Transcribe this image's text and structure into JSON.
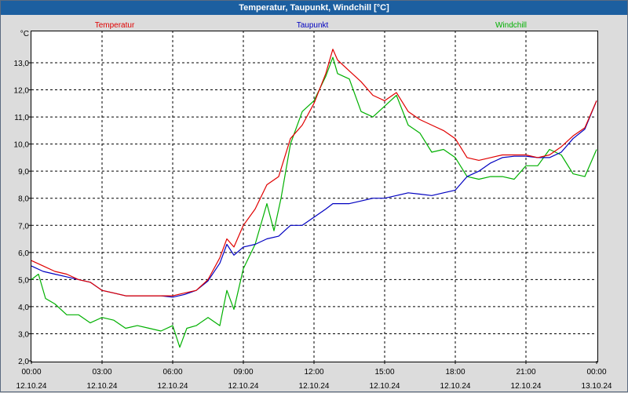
{
  "window": {
    "title": "Temperatur, Taupunkt, Windchill [°C]"
  },
  "chart_data": {
    "type": "line",
    "title": "Temperatur, Taupunkt, Windchill [°C]",
    "ylabel": "°C",
    "xlabel": "",
    "ylim": [
      2.0,
      14.0
    ],
    "xlim_hours": [
      0,
      24
    ],
    "y_ticks": [
      "2,0",
      "3,0",
      "4,0",
      "5,0",
      "6,0",
      "7,0",
      "8,0",
      "9,0",
      "10,0",
      "11,0",
      "12,0",
      "13,0"
    ],
    "x_ticks": [
      {
        "time": "00:00",
        "date": "12.10.24"
      },
      {
        "time": "03:00",
        "date": "12.10.24"
      },
      {
        "time": "06:00",
        "date": "12.10.24"
      },
      {
        "time": "09:00",
        "date": "12.10.24"
      },
      {
        "time": "12:00",
        "date": "12.10.24"
      },
      {
        "time": "15:00",
        "date": "12.10.24"
      },
      {
        "time": "18:00",
        "date": "12.10.24"
      },
      {
        "time": "21:00",
        "date": "12.10.24"
      },
      {
        "time": "00:00",
        "date": "13.10.24"
      }
    ],
    "grid": true,
    "legend_placement": "top",
    "series": [
      {
        "name": "Temperatur",
        "color": "#e00000",
        "x": [
          0,
          0.5,
          1,
          1.5,
          2,
          2.5,
          3,
          3.5,
          4,
          4.5,
          5,
          5.5,
          6,
          6.5,
          7,
          7.5,
          8,
          8.3,
          8.6,
          9,
          9.5,
          10,
          10.5,
          11,
          11.5,
          12,
          12.5,
          12.8,
          13,
          13.5,
          14,
          14.5,
          15,
          15.5,
          16,
          16.5,
          17,
          17.5,
          18,
          18.5,
          19,
          19.5,
          20,
          20.5,
          21,
          21.5,
          22,
          22.5,
          23,
          23.5,
          24
        ],
        "y": [
          5.7,
          5.5,
          5.3,
          5.2,
          5.0,
          4.9,
          4.6,
          4.5,
          4.4,
          4.4,
          4.4,
          4.4,
          4.4,
          4.5,
          4.6,
          5.0,
          5.8,
          6.5,
          6.2,
          7.0,
          7.6,
          8.5,
          8.8,
          10.2,
          10.7,
          11.5,
          12.6,
          13.5,
          13.1,
          12.7,
          12.3,
          11.8,
          11.6,
          11.9,
          11.2,
          10.9,
          10.7,
          10.5,
          10.2,
          9.5,
          9.4,
          9.5,
          9.6,
          9.6,
          9.6,
          9.5,
          9.6,
          9.9,
          10.3,
          10.6,
          11.6
        ]
      },
      {
        "name": "Taupunkt",
        "color": "#0000c0",
        "x": [
          0,
          0.5,
          1,
          1.5,
          2,
          2.5,
          3,
          3.5,
          4,
          4.5,
          5,
          5.5,
          6,
          6.5,
          7,
          7.5,
          8,
          8.3,
          8.6,
          9,
          9.5,
          10,
          10.5,
          11,
          11.5,
          12,
          12.5,
          12.8,
          13,
          13.5,
          14,
          14.5,
          15,
          15.5,
          16,
          16.5,
          17,
          17.5,
          18,
          18.5,
          19,
          19.5,
          20,
          20.5,
          21,
          21.5,
          22,
          22.5,
          23,
          23.5,
          24
        ],
        "y": [
          5.5,
          5.3,
          5.2,
          5.1,
          5.0,
          4.9,
          4.6,
          4.5,
          4.4,
          4.4,
          4.4,
          4.4,
          4.35,
          4.45,
          4.6,
          4.95,
          5.6,
          6.3,
          5.9,
          6.2,
          6.3,
          6.5,
          6.6,
          7.0,
          7.0,
          7.3,
          7.6,
          7.8,
          7.8,
          7.8,
          7.9,
          8.0,
          8.0,
          8.1,
          8.2,
          8.15,
          8.1,
          8.2,
          8.3,
          8.8,
          9.0,
          9.3,
          9.5,
          9.55,
          9.55,
          9.5,
          9.5,
          9.7,
          10.2,
          10.55,
          11.6
        ]
      },
      {
        "name": "Windchill",
        "color": "#00b000",
        "x": [
          0,
          0.3,
          0.6,
          1,
          1.5,
          2,
          2.5,
          3,
          3.5,
          4,
          4.5,
          5,
          5.5,
          6,
          6.3,
          6.6,
          7,
          7.5,
          8,
          8.3,
          8.6,
          9,
          9.5,
          10,
          10.3,
          10.6,
          11,
          11.5,
          12,
          12.5,
          12.8,
          13,
          13.5,
          14,
          14.5,
          15,
          15.5,
          16,
          16.5,
          17,
          17.5,
          18,
          18.5,
          19,
          19.5,
          20,
          20.5,
          21,
          21.5,
          22,
          22.5,
          23,
          23.5,
          24
        ],
        "y": [
          5.0,
          5.2,
          4.3,
          4.1,
          3.7,
          3.7,
          3.4,
          3.6,
          3.5,
          3.2,
          3.3,
          3.2,
          3.1,
          3.3,
          2.5,
          3.2,
          3.3,
          3.6,
          3.3,
          4.6,
          3.9,
          5.4,
          6.3,
          7.8,
          6.8,
          8.0,
          10.0,
          11.2,
          11.6,
          12.5,
          13.2,
          12.6,
          12.4,
          11.2,
          11.0,
          11.4,
          11.8,
          10.7,
          10.4,
          9.7,
          9.8,
          9.5,
          8.8,
          8.7,
          8.8,
          8.8,
          8.7,
          9.2,
          9.2,
          9.8,
          9.6,
          8.9,
          8.8,
          9.8
        ]
      }
    ]
  }
}
